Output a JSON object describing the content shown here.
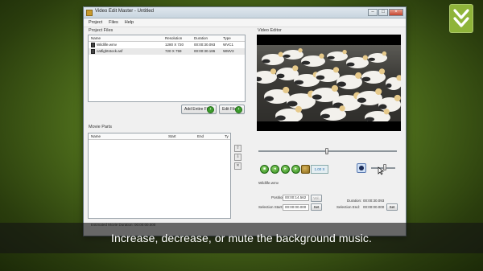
{
  "window": {
    "title": "Video Edit Master - Untitled",
    "minimize": "–",
    "maximize": "□",
    "close": "×"
  },
  "menu": [
    "Project",
    "Files",
    "Help"
  ],
  "project_files": {
    "label": "Project Files",
    "columns": [
      "Name",
      "Resolution",
      "Duration",
      "Type"
    ],
    "rows": [
      {
        "name": "Wildlife.wmv",
        "resolution": "1280 X 720",
        "duration": "00:00:30.093",
        "type": "WVC1"
      },
      {
        "name": "catfightstock.asf",
        "resolution": "720 X 759",
        "duration": "00:00:30.186",
        "type": "WMV3"
      }
    ],
    "add_button": "Add Entire File",
    "edit_button": "Edit File"
  },
  "movie_parts": {
    "label": "Movie Parts",
    "columns": [
      "Name",
      "Start",
      "End",
      "Ty"
    ]
  },
  "estimated_duration": "Estimated Movie Duration: 00:00:00.000",
  "video_editor": {
    "label": "Video Editor",
    "speed": "1.00 X",
    "filename": "Wildlife.wmv",
    "position_label": "Position:",
    "position_value": "00:00:14.562",
    "position_btn": "Vol.",
    "selection_start_label": "Selection Start:",
    "selection_start_value": "00:00:00.000",
    "set_label": "Set",
    "duration_label": "Duration:",
    "duration_value": "00:00:30.093",
    "selection_end_label": "Selection End:",
    "selection_end_value": "00:00:00.000"
  },
  "caption": "Increase, decrease, or mute the background music."
}
